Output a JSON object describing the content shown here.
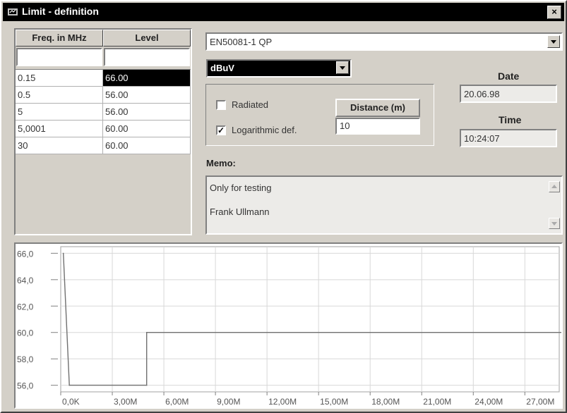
{
  "window": {
    "title": "Limit - definition",
    "close_label": "×"
  },
  "table": {
    "headers": [
      "Freq. in MHz",
      "Level"
    ],
    "rows": [
      [
        "0.15",
        "66.00"
      ],
      [
        "0.5",
        "56.00"
      ],
      [
        "5",
        "56.00"
      ],
      [
        "5,0001",
        "60.00"
      ],
      [
        "30",
        "60.00"
      ]
    ],
    "selected": {
      "row": 0,
      "col": 1
    }
  },
  "standard": {
    "value": "EN50081-1 QP"
  },
  "unit": {
    "value": "dBuV"
  },
  "options": {
    "radiated_label": "Radiated",
    "radiated_checked": false,
    "log_label": "Logarithmic def.",
    "log_checked": true,
    "check_mark": "✓"
  },
  "distance": {
    "label": "Distance (m)",
    "value": "10"
  },
  "date": {
    "label": "Date",
    "value": "20.06.98"
  },
  "time": {
    "label": "Time",
    "value": "10:24:07"
  },
  "memo": {
    "label": "Memo:",
    "lines": [
      "Only for testing",
      "Frank Ullmann"
    ]
  },
  "chart_data": {
    "type": "line",
    "x_unit": "Hz",
    "xlim": [
      0,
      29000000
    ],
    "ylim": [
      55.5,
      66.5
    ],
    "x_ticks": [
      0,
      3000000,
      6000000,
      9000000,
      12000000,
      15000000,
      18000000,
      21000000,
      24000000,
      27000000
    ],
    "x_tick_labels": [
      "0,0K",
      "3,00M",
      "6,00M",
      "9,00M",
      "12,00M",
      "15,00M",
      "18,00M",
      "21,00M",
      "24,00M",
      "27,00M"
    ],
    "y_ticks": [
      56,
      58,
      60,
      62,
      64,
      66
    ],
    "y_tick_labels": [
      "56,0",
      "58,0",
      "60,0",
      "62,0",
      "64,0",
      "66,0"
    ],
    "grid": true,
    "series": [
      {
        "x": [
          150000,
          500000,
          5000000,
          5000100,
          30000000
        ],
        "y": [
          66.0,
          56.0,
          56.0,
          60.0,
          60.0
        ],
        "color": "#707070"
      }
    ]
  }
}
